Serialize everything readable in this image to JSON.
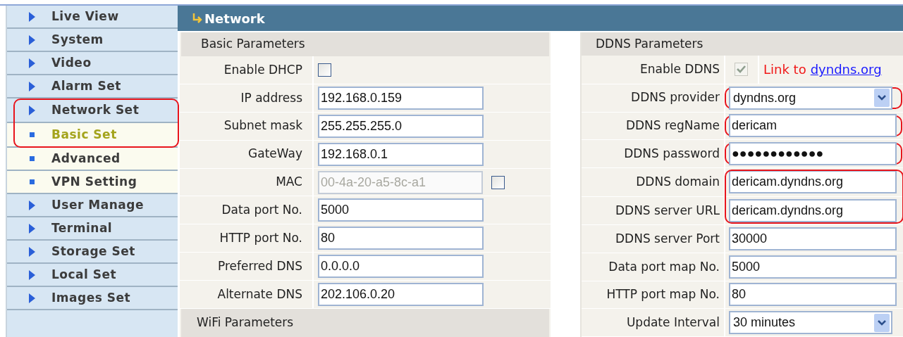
{
  "sidebar": {
    "items": [
      {
        "label": "Live View",
        "kind": "menu",
        "selected": false
      },
      {
        "label": "System",
        "kind": "menu",
        "selected": false
      },
      {
        "label": "Video",
        "kind": "menu",
        "selected": false
      },
      {
        "label": "Alarm Set",
        "kind": "menu",
        "selected": false
      },
      {
        "kind": "highlight_group",
        "items": [
          {
            "label": "Network Set",
            "kind": "menu",
            "selected": false
          },
          {
            "label": "Basic Set",
            "kind": "sub",
            "selected": true
          }
        ]
      },
      {
        "label": "Advanced",
        "kind": "sub",
        "selected": false
      },
      {
        "label": "VPN Setting",
        "kind": "sub",
        "selected": false
      },
      {
        "label": "User Manage",
        "kind": "menu",
        "selected": false
      },
      {
        "label": "Terminal",
        "kind": "menu",
        "selected": false
      },
      {
        "label": "Storage Set",
        "kind": "menu",
        "selected": false
      },
      {
        "label": "Local Set",
        "kind": "menu",
        "selected": false
      },
      {
        "label": "Images Set",
        "kind": "menu",
        "selected": false
      }
    ]
  },
  "header": {
    "title": "Network"
  },
  "basic": {
    "title": "Basic Parameters",
    "rows": [
      {
        "label": "Enable DHCP",
        "kind": "checkbox",
        "checked": false
      },
      {
        "label": "IP address",
        "kind": "text",
        "value": "192.168.0.159"
      },
      {
        "label": "Subnet mask",
        "kind": "text",
        "value": "255.255.255.0"
      },
      {
        "label": "GateWay",
        "kind": "text",
        "value": "192.168.0.1"
      },
      {
        "label": "MAC",
        "kind": "mac",
        "value": "00-4a-20-a5-8c-a1",
        "disabled": true,
        "checked": false
      },
      {
        "label": "Data port No.",
        "kind": "text",
        "value": "5000"
      },
      {
        "label": "HTTP port No.",
        "kind": "text",
        "value": "80"
      },
      {
        "label": "Preferred DNS",
        "kind": "text",
        "value": "0.0.0.0"
      },
      {
        "label": "Alternate DNS",
        "kind": "text",
        "value": "202.106.0.20"
      }
    ],
    "next_section": "WiFi Parameters"
  },
  "ddns": {
    "title": "DDNS Parameters",
    "rows": [
      {
        "label": "Enable DDNS",
        "kind": "checkbox_link",
        "checked": true,
        "disabled": true,
        "note": "Link to",
        "link": "dyndns.org",
        "highlighted": false
      },
      {
        "label": "DDNS provider",
        "kind": "select",
        "value": "dyndns.org",
        "highlighted": true
      },
      {
        "label": "DDNS regName",
        "kind": "text",
        "value": "dericam",
        "highlighted": true
      },
      {
        "label": "DDNS password",
        "kind": "text",
        "value": "●●●●●●●●●●●●",
        "highlighted": true
      },
      {
        "kind": "highlight_group",
        "rows": [
          {
            "label": "DDNS domain",
            "kind": "text",
            "value": "dericam.dyndns.org"
          },
          {
            "label": "DDNS server URL",
            "kind": "text",
            "value": "dericam.dyndns.org"
          }
        ]
      },
      {
        "label": "DDNS server Port",
        "kind": "text",
        "value": "30000",
        "highlighted": false
      },
      {
        "label": "Data port map No.",
        "kind": "text",
        "value": "5000",
        "highlighted": false
      },
      {
        "label": "HTTP port map No.",
        "kind": "text",
        "value": "80",
        "highlighted": false
      },
      {
        "label": "Update Interval",
        "kind": "select",
        "value": "30 minutes",
        "highlighted": false
      }
    ]
  }
}
